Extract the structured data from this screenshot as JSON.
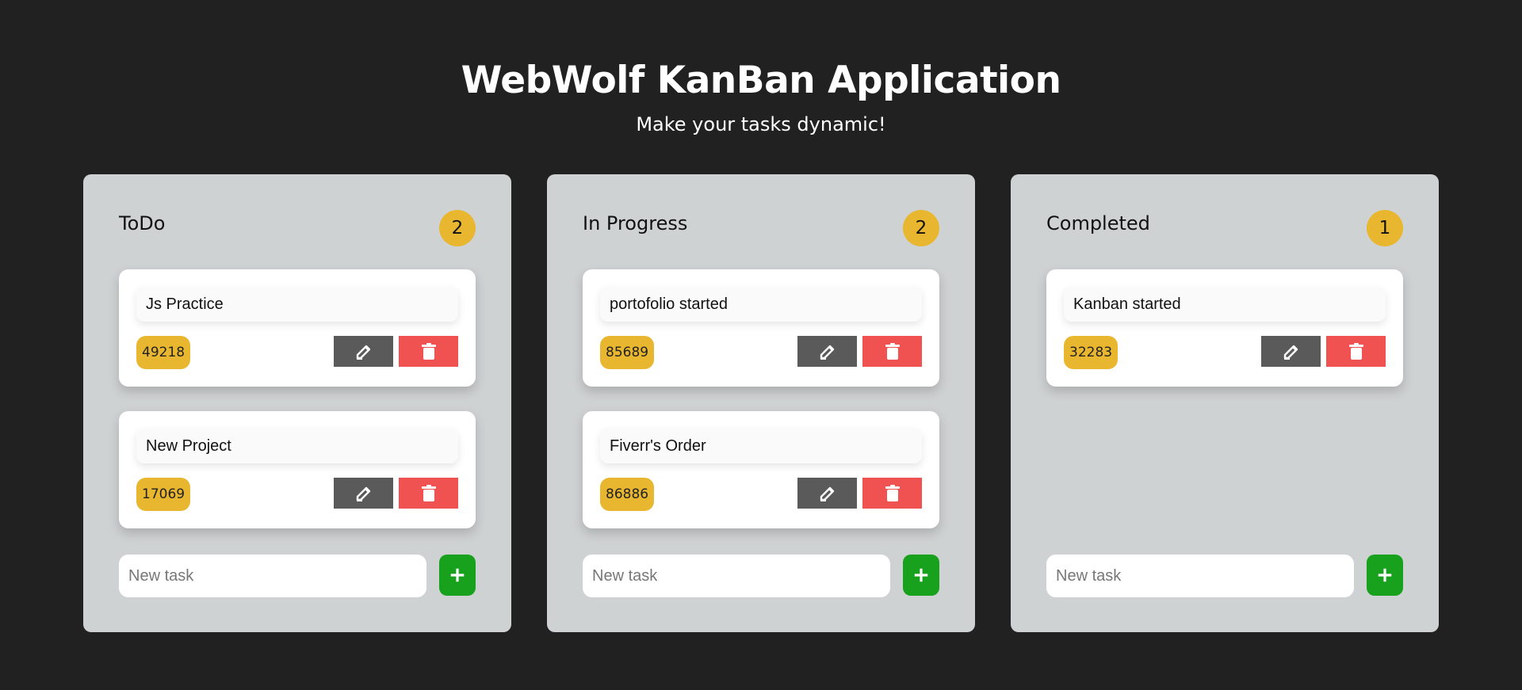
{
  "header": {
    "title": "WebWolf KanBan Application",
    "subtitle": "Make your tasks dynamic!"
  },
  "colors": {
    "background": "#212121",
    "column": "#cfd2d3",
    "badge": "#e9b62f",
    "edit": "#5a5a5a",
    "delete": "#f05252",
    "add": "#17a11d"
  },
  "columns": [
    {
      "title": "ToDo",
      "count": "2",
      "tasks": [
        {
          "name": "Js Practice",
          "id": "49218"
        },
        {
          "name": "New Project",
          "id": "17069"
        }
      ],
      "new_task_placeholder": "New task"
    },
    {
      "title": "In Progress",
      "count": "2",
      "tasks": [
        {
          "name": "portofolio started",
          "id": "85689"
        },
        {
          "name": "Fiverr's Order",
          "id": "86886"
        }
      ],
      "new_task_placeholder": "New task"
    },
    {
      "title": "Completed",
      "count": "1",
      "tasks": [
        {
          "name": "Kanban started",
          "id": "32283"
        }
      ],
      "new_task_placeholder": "New task"
    }
  ],
  "icons": {
    "edit": "edit-icon",
    "delete": "trash-icon",
    "add": "plus-icon"
  }
}
